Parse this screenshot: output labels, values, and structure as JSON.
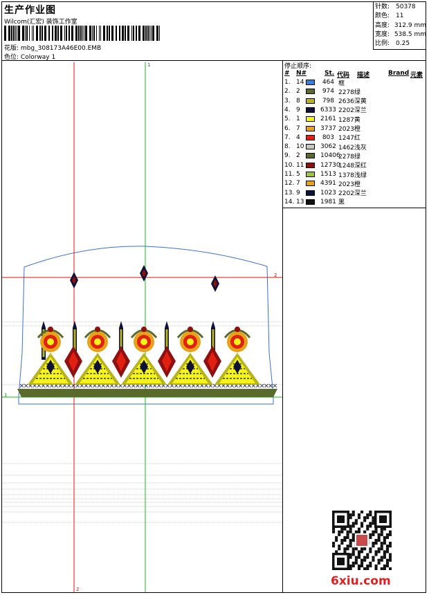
{
  "header": {
    "title": "生产作业图",
    "company": "Wilcom(汇宏) 装饰工作室",
    "design_label": "花版:",
    "design_value": "mbg_308173A46E00.EMB",
    "colorway_label": "色位:",
    "colorway_value": "Colorway 1"
  },
  "stats": [
    {
      "label": "针数:",
      "value": "50378"
    },
    {
      "label": "颜色:",
      "value": "11"
    },
    {
      "label": "高度:",
      "value": "312.9 mm"
    },
    {
      "label": "宽度:",
      "value": "538.5 mm"
    },
    {
      "label": "比例:",
      "value": "0.25"
    }
  ],
  "sequence": {
    "header": "停止顺序:",
    "columns": {
      "idx": "#",
      "n": "N#",
      "st": "St.",
      "code": "代码",
      "desc": "描述",
      "brand": "Brand",
      "element": "元素"
    },
    "rows": [
      {
        "idx": "1.",
        "n": "14",
        "color": "#3a7fd5",
        "st": "464",
        "code": "",
        "desc": "框"
      },
      {
        "idx": "2.",
        "n": "2",
        "color": "#596a2c",
        "st": "974",
        "code": "2278",
        "desc": "绿"
      },
      {
        "idx": "3.",
        "n": "8",
        "color": "#b7b41d",
        "st": "798",
        "code": "2636",
        "desc": "深黄"
      },
      {
        "idx": "4.",
        "n": "9",
        "color": "#0e1235",
        "st": "6333",
        "code": "2202",
        "desc": "深兰"
      },
      {
        "idx": "5.",
        "n": "1",
        "color": "#f7f21a",
        "st": "2161",
        "code": "1287",
        "desc": "黄"
      },
      {
        "idx": "6.",
        "n": "7",
        "color": "#e8a21a",
        "st": "3737",
        "code": "2023",
        "desc": "橙"
      },
      {
        "idx": "7.",
        "n": "4",
        "color": "#e02010",
        "st": "803",
        "code": "1247",
        "desc": "红"
      },
      {
        "idx": "8.",
        "n": "10",
        "color": "#c8c8c0",
        "st": "3062",
        "code": "1462",
        "desc": "浅灰"
      },
      {
        "idx": "9.",
        "n": "2",
        "color": "#596a2c",
        "st": "10406",
        "code": "2278",
        "desc": "绿"
      },
      {
        "idx": "10.",
        "n": "11",
        "color": "#8e1010",
        "st": "12730",
        "code": "1248",
        "desc": "深红"
      },
      {
        "idx": "11.",
        "n": "5",
        "color": "#a6c23a",
        "st": "1513",
        "code": "1378",
        "desc": "浅绿"
      },
      {
        "idx": "12.",
        "n": "7",
        "color": "#e8a21a",
        "st": "4391",
        "code": "2023",
        "desc": "橙"
      },
      {
        "idx": "13.",
        "n": "9",
        "color": "#0e1235",
        "st": "1023",
        "code": "2202",
        "desc": "深兰"
      },
      {
        "idx": "14.",
        "n": "13",
        "color": "#111111",
        "st": "1981",
        "code": "",
        "desc": "黑"
      }
    ]
  },
  "guides": {
    "mark_top": "1",
    "mark_right": "2",
    "mark_left": "1",
    "mark_bottom": "2"
  },
  "footer": {
    "site": "6xiu.com"
  }
}
